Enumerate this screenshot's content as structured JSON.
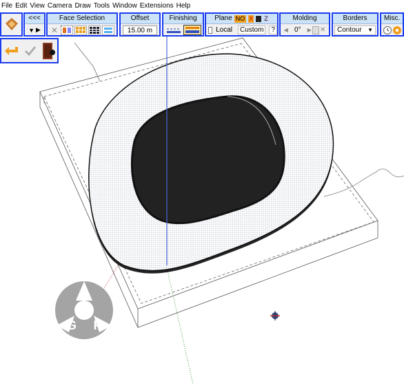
{
  "menu": [
    "File",
    "Edit",
    "View",
    "Camera",
    "Draw",
    "Tools",
    "Window",
    "Extensions",
    "Help"
  ],
  "toolbars": {
    "nav": {
      "label": "<<<"
    },
    "face_selection": {
      "title": "Face Selection"
    },
    "offset": {
      "title": "Offset",
      "value": "15.00 m"
    },
    "finishing": {
      "title": "Finishing"
    },
    "plane": {
      "title": "Plane",
      "no_label": "NO",
      "x_label": "X",
      "z_label": "Z",
      "local_label": "Local",
      "custom_label": "Custom",
      "help_label": "?"
    },
    "molding": {
      "title": "Molding",
      "angle": "0°"
    },
    "borders": {
      "title": "Borders",
      "mode": "Contour"
    },
    "misc": {
      "title": "Misc."
    }
  },
  "watermark": [
    "A",
    "G",
    "R"
  ],
  "colors": {
    "toolbar_border": "#1a3cf0",
    "header_bg": "#cce3f7",
    "accent_orange": "#f0a020",
    "axis_blue": "#4a6ad8"
  }
}
